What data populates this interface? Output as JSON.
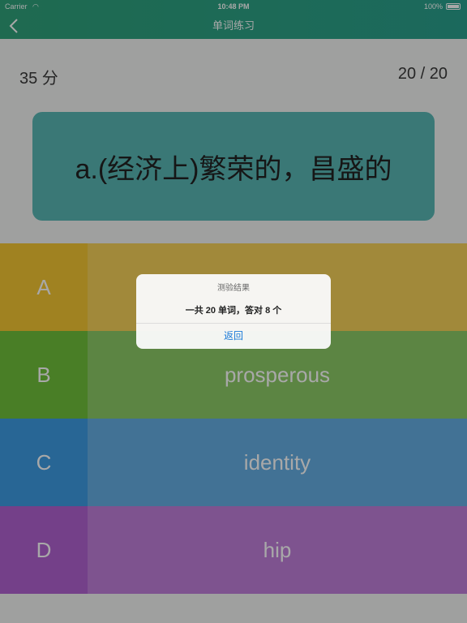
{
  "status_bar": {
    "carrier": "Carrier",
    "time": "10:48 PM",
    "battery": "100%"
  },
  "nav": {
    "title": "单词练习",
    "back_icon": "chevron-left-icon"
  },
  "score": {
    "points": "35 分",
    "progress": "20 / 20"
  },
  "question": {
    "text": "a.(经济上)繁荣的，昌盛的"
  },
  "options": [
    {
      "letter": "A",
      "text": ""
    },
    {
      "letter": "B",
      "text": "prosperous"
    },
    {
      "letter": "C",
      "text": "identity"
    },
    {
      "letter": "D",
      "text": "hip"
    }
  ],
  "alert": {
    "title": "测验结果",
    "message": "一共 20 单词，答对 8 个",
    "button": "返回"
  },
  "colors": {
    "header": "#2fa27a",
    "question_card": "#58b6b4",
    "option_a": "#f3c632",
    "option_b": "#6fbf3a",
    "option_c": "#3d9be2",
    "option_d": "#b062d0",
    "alert_button": "#1a7ad9"
  }
}
